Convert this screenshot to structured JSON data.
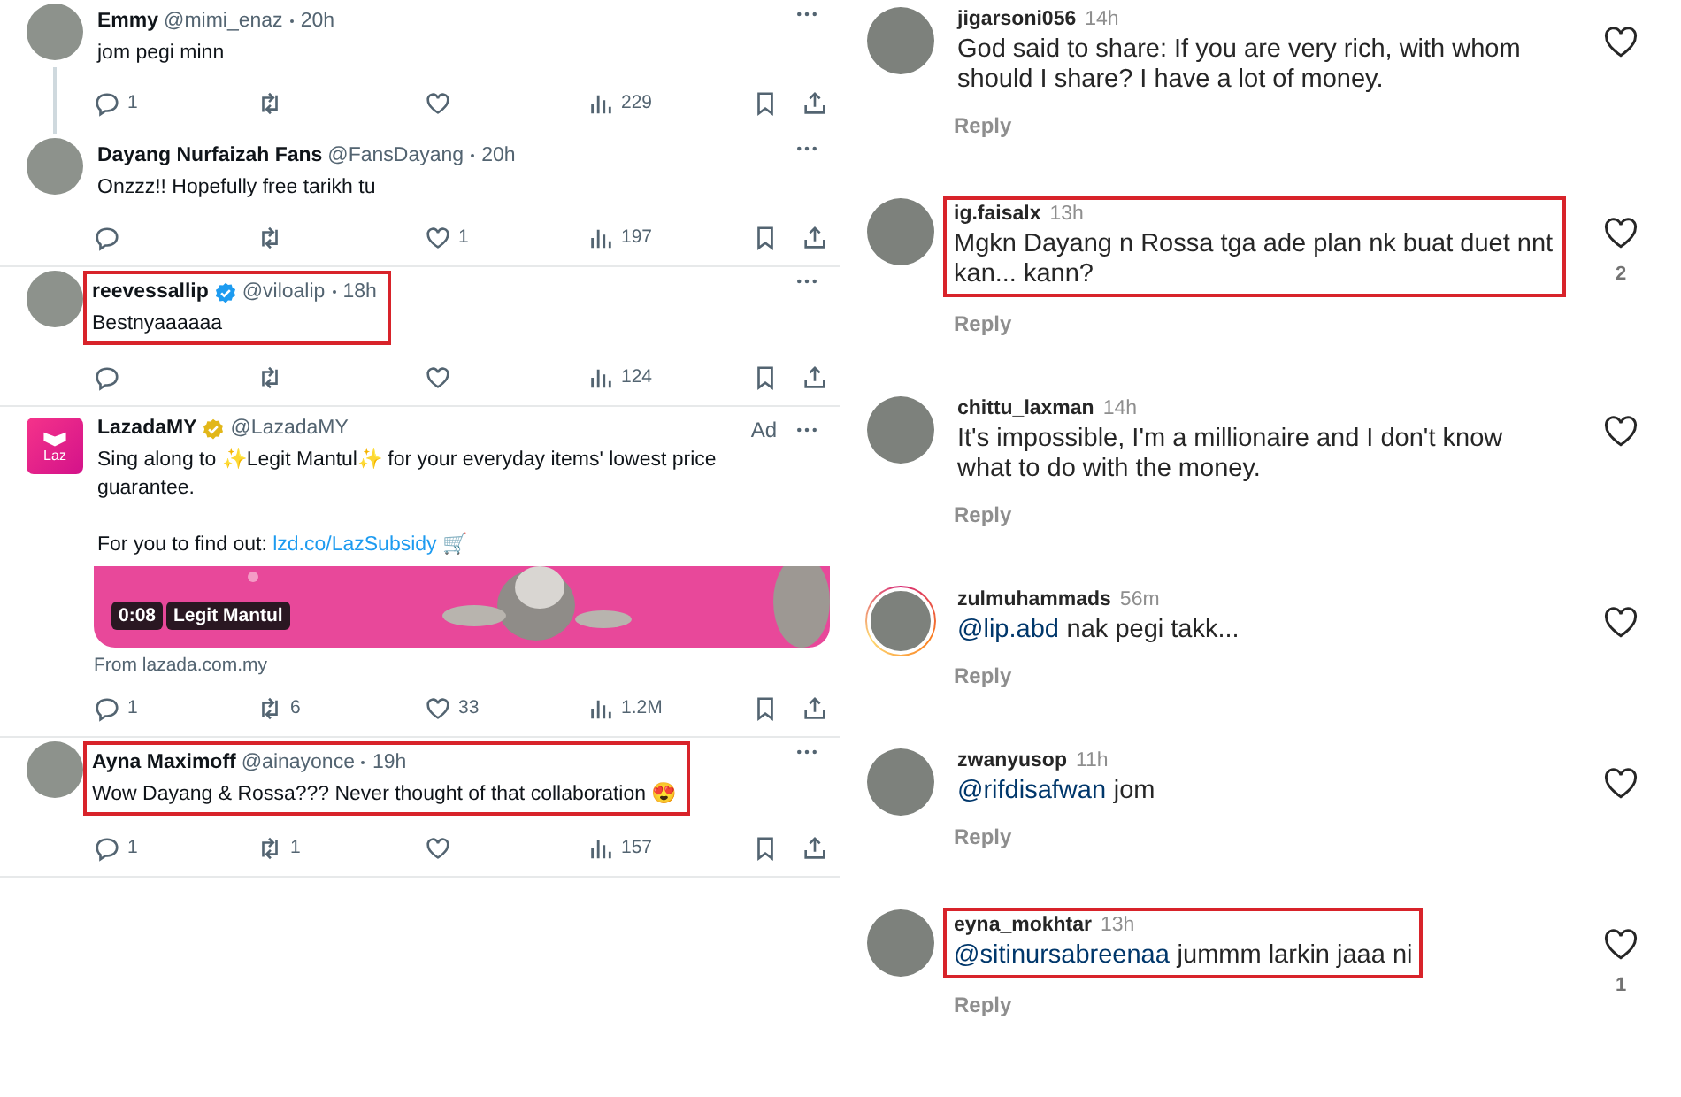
{
  "tweets": [
    {
      "kind": "reply",
      "name": "Emmy",
      "handle": "@mimi_enaz",
      "time": "20h",
      "text": "jom pegi minn",
      "thread_line": true,
      "actions": {
        "reply": "1",
        "views": "229"
      }
    },
    {
      "kind": "reply",
      "name": "Dayang Nurfaizah Fans",
      "handle": "@FansDayang",
      "time": "20h",
      "text": "Onzzz!! Hopefully free tarikh tu",
      "actions": {
        "like": "1",
        "views": "197"
      }
    },
    {
      "kind": "reply",
      "name": "reevessallip",
      "handle": "@viloalip",
      "time": "18h",
      "text": "Bestnyaaaaaa",
      "verified": {
        "color": "#1d9bf0"
      },
      "highlighted": true,
      "actions": {
        "views": "124"
      }
    },
    {
      "kind": "ad",
      "name": "LazadaMY",
      "handle": "@LazadaMY",
      "ad_label": "Ad",
      "logo_text": "Laz",
      "text": "Sing along to ✨Legit Mantul✨ for your everyday items' lowest price guarantee.",
      "link_prefix": "For you to find out:",
      "link": "lzd.co/LazSubsidy",
      "link_suffix": "🛒",
      "verified": {
        "color": "#e2b719"
      },
      "media": {
        "kind": "picture",
        "duration": "0:08",
        "title": "Legit Mantul"
      },
      "source": "From lazada.com.my",
      "actions": {
        "reply": "1",
        "retweet": "6",
        "like": "33",
        "views": "1.2M"
      }
    },
    {
      "kind": "reply",
      "name": "Ayna Maximoff",
      "handle": "@ainayonce",
      "time": "19h",
      "text": "Wow Dayang & Rossa??? Never thought of that collaboration 😍",
      "highlighted": true,
      "actions": {
        "reply": "1",
        "retweet": "1",
        "views": "157"
      }
    }
  ],
  "comments": [
    {
      "username": "jigarsoni056",
      "time": "14h",
      "text": "God said to share: If you are very rich, with whom should I share? I have a lot of money.",
      "reply_label": "Reply"
    },
    {
      "username": "ig.faisalx",
      "time": "13h",
      "text": "Mgkn Dayang n Rossa tga ade plan nk buat duet nnt kan... kann?",
      "reply_label": "Reply",
      "likes": "2",
      "highlighted": true
    },
    {
      "username": "chittu_laxman",
      "time": "14h",
      "text": "It's impossible, I'm a millionaire and I don't know what to do with the money.",
      "reply_label": "Reply"
    },
    {
      "username": "zulmuhammads",
      "time": "56m",
      "mention": "@lip.abd",
      "text": "nak pegi takk...",
      "reply_label": "Reply",
      "story_ring": true
    },
    {
      "username": "zwanyusop",
      "time": "11h",
      "mention": "@rifdisafwan",
      "text": "jom",
      "reply_label": "Reply"
    },
    {
      "username": "eyna_mokhtar",
      "time": "13h",
      "mention": "@sitinursabreenaa",
      "text": "jummm larkin jaaa ni",
      "reply_label": "Reply",
      "likes": "1",
      "highlighted": true
    }
  ]
}
